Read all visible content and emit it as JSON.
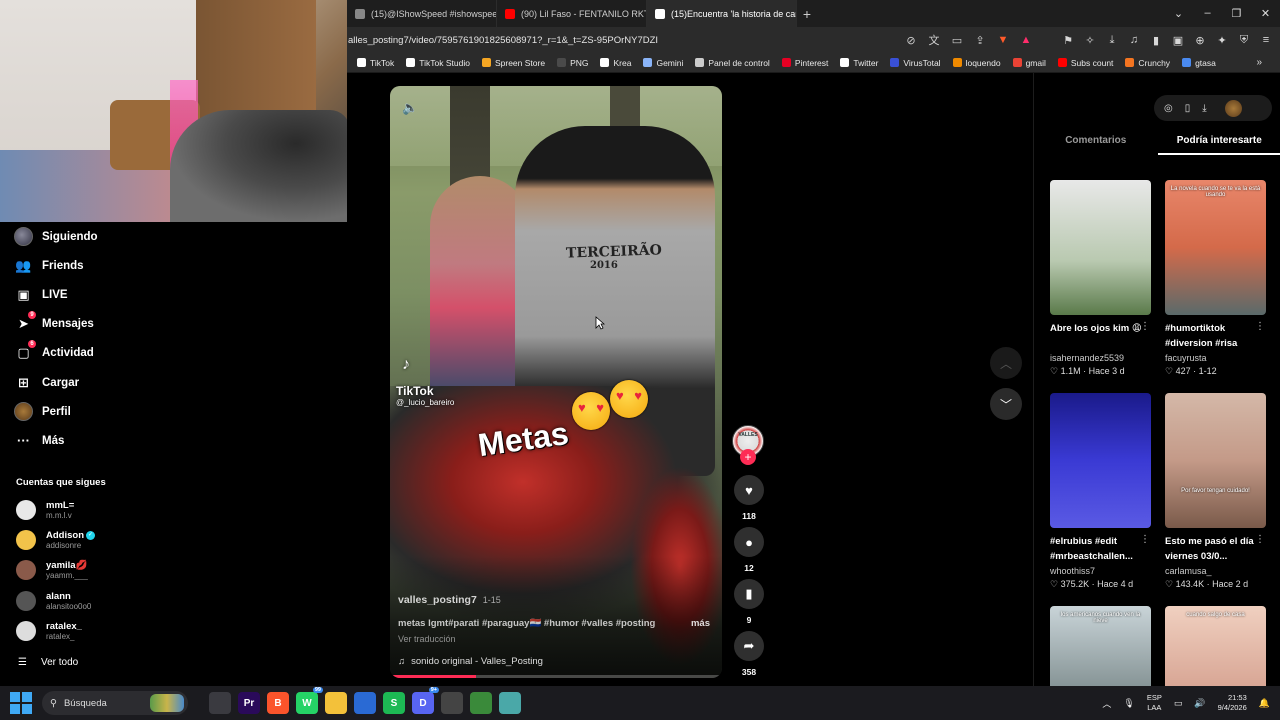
{
  "browser": {
    "tabs": [
      {
        "title": "(15)@IShowSpeed #ishowspeed #ba",
        "color": "#888888",
        "active": false
      },
      {
        "title": "(90) Lil Faso - FENTANILO RKT - YouT",
        "color": "#ff0000",
        "active": false
      },
      {
        "title": "(15)Encuentra 'la historia de camila' e",
        "color": "#ffffff",
        "active": true
      }
    ],
    "new_tab": "+",
    "url": "alles_posting7/video/7595761901825608971?_r=1&_t=ZS-95POrNY7DZI",
    "bookmarks": [
      {
        "label": "TikTok",
        "color": "#ffffff"
      },
      {
        "label": "TikTok Studio",
        "color": "#ffffff"
      },
      {
        "label": "Spreen Store",
        "color": "#f5a623"
      },
      {
        "label": "PNG",
        "color": "#4a4a4a"
      },
      {
        "label": "Krea",
        "color": "#ffffff"
      },
      {
        "label": "Gemini",
        "color": "#8ab4f8"
      },
      {
        "label": "Panel de control",
        "color": "#cccccc"
      },
      {
        "label": "Pinterest",
        "color": "#e60023"
      },
      {
        "label": "Twitter",
        "color": "#ffffff"
      },
      {
        "label": "VirusTotal",
        "color": "#3950d6"
      },
      {
        "label": "loquendo",
        "color": "#f08a00"
      },
      {
        "label": "gmail",
        "color": "#ea4335"
      },
      {
        "label": "Subs count",
        "color": "#ff0000"
      },
      {
        "label": "Crunchy",
        "color": "#f47521"
      },
      {
        "label": "gtasa",
        "color": "#4a8af0"
      }
    ]
  },
  "sidebar": {
    "items": [
      {
        "label": "Siguiendo",
        "icon": "following-avatar-icon",
        "badge": ""
      },
      {
        "label": "Friends",
        "icon": "friends-icon",
        "badge": ""
      },
      {
        "label": "LIVE",
        "icon": "live-icon",
        "badge": ""
      },
      {
        "label": "Mensajes",
        "icon": "messages-icon",
        "badge": "9"
      },
      {
        "label": "Actividad",
        "icon": "activity-icon",
        "badge": "6"
      },
      {
        "label": "Cargar",
        "icon": "upload-icon",
        "badge": ""
      },
      {
        "label": "Perfil",
        "icon": "profile-avatar-icon",
        "badge": ""
      },
      {
        "label": "Más",
        "icon": "more-icon",
        "badge": ""
      }
    ],
    "following_title": "Cuentas que sigues",
    "accounts": [
      {
        "name": "mmL=",
        "user": "m.m.l.v",
        "color": "#e8e8e8",
        "verified": false,
        "emoji": ""
      },
      {
        "name": "Addison",
        "user": "addisonre",
        "color": "#f2c34a",
        "verified": true,
        "emoji": ""
      },
      {
        "name": "yamila",
        "user": "yaamm.___",
        "color": "#8a5a4a",
        "verified": false,
        "emoji": "💋"
      },
      {
        "name": "alann",
        "user": "alansitoo0o0",
        "color": "#555555",
        "verified": false,
        "emoji": ""
      },
      {
        "name": "ratalex_",
        "user": "ratalex_",
        "color": "#dddddd",
        "verified": false,
        "emoji": ""
      }
    ],
    "see_all": "Ver todo"
  },
  "video": {
    "shirt_text": "TERCEIRÃO",
    "shirt_year": "2016",
    "watermark_brand": "TikTok",
    "watermark_handle": "@_lucio_bareiro",
    "overlay_text": "Metas",
    "username": "valles_posting7",
    "date": "1-15",
    "caption": "metas lgmt#parati #paraguay🇵🇾 #humor #valles #posting",
    "more": "más",
    "translate": "Ver traducción",
    "sound": "sonido original - Valles_Posting",
    "progress": 0.26
  },
  "rail": {
    "avatar_text": "VALLES",
    "likes": "118",
    "comments": "12",
    "saves": "9",
    "shares": "358"
  },
  "right_panel": {
    "tabs": [
      "Comentarios",
      "Podría interesarte"
    ],
    "active_tab": 1,
    "cards": [
      {
        "title": "Abre los ojos kim 😩",
        "author": "isahernandez5539",
        "likes": "1.1M",
        "when": "Hace 3 d",
        "bg": "linear-gradient(180deg,#e8e8e8,#b9c9b0 60%,#5a7a4a)",
        "overlay": ""
      },
      {
        "title": "#humortiktok #diversion #risa",
        "author": "facuyrusta",
        "likes": "427",
        "when": "1-12",
        "bg": "linear-gradient(180deg,#e8866a,#d46a4a 50%,#5a6a6a)",
        "overlay": "La novela cuando se te va la está usando"
      },
      {
        "title": "#elrubius #edit #mrbeastchallen...",
        "author": "whoothiss7",
        "likes": "375.2K",
        "when": "Hace 4 d",
        "bg": "linear-gradient(180deg,#1a1a8a,#3a3ad4 50%,#5a5ae4)",
        "overlay": ""
      },
      {
        "title": "Esto me pasó el día viernes 03/0...",
        "author": "carlamusa_",
        "likes": "143.4K",
        "when": "Hace 2 d",
        "bg": "linear-gradient(180deg,#d4b8a8,#c49a88 50%,#7a5a4a)",
        "overlay": "Por favor tengan cuidado!"
      },
      {
        "title": "",
        "author": "",
        "likes": "",
        "when": "",
        "bg": "linear-gradient(180deg,#c9d4d8,#5a6a6a)",
        "overlay": "los americanos cuando ven la nieve"
      },
      {
        "title": "",
        "author": "",
        "likes": "",
        "when": "",
        "bg": "linear-gradient(180deg,#f0d0c0,#c88a78)",
        "overlay": "cuando salgo de casa"
      }
    ]
  },
  "taskbar": {
    "search": "Búsqueda",
    "apps": [
      {
        "label": "",
        "color": "#3a3a40",
        "name": "task-view-icon"
      },
      {
        "label": "Pr",
        "color": "#2a0a5a",
        "name": "premiere-icon"
      },
      {
        "label": "B",
        "color": "#fb542b",
        "name": "brave-icon"
      },
      {
        "label": "W",
        "color": "#25d366",
        "name": "whatsapp-icon",
        "badge": "99"
      },
      {
        "label": "",
        "color": "#f3c13a",
        "name": "file-explorer-icon"
      },
      {
        "label": "",
        "color": "#2a6ad4",
        "name": "store-icon"
      },
      {
        "label": "S",
        "color": "#1db954",
        "name": "spotify-icon"
      },
      {
        "label": "D",
        "color": "#5865f2",
        "name": "discord-icon",
        "badge": "9+"
      },
      {
        "label": "",
        "color": "#444444",
        "name": "steam-icon"
      },
      {
        "label": "",
        "color": "#3a8a3a",
        "name": "minecraft-icon"
      },
      {
        "label": "",
        "color": "#4aa8a8",
        "name": "notepad-icon"
      }
    ],
    "lang": [
      "ESP",
      "LAA"
    ],
    "time": "21:53",
    "date": "9/4/2026"
  }
}
